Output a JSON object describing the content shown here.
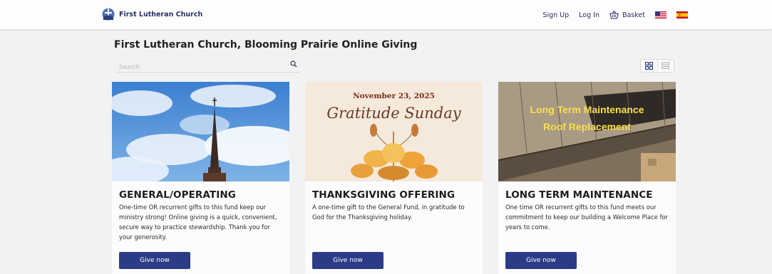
{
  "header": {
    "brand_name": "First Lutheran Church",
    "nav": {
      "signup": "Sign Up",
      "login": "Log In",
      "basket": "Basket"
    }
  },
  "page": {
    "title": "First Lutheran Church, Blooming Prairie Online Giving"
  },
  "search": {
    "placeholder": "Search"
  },
  "cards": [
    {
      "heading": "GENERAL/OPERATING",
      "description": "One-time OR recurrent gifts to this fund keep our ministry strong! Online giving is a quick, convenient, secure way to practice stewardship. Thank you for your generosity.",
      "button": "Give now"
    },
    {
      "image_date": "November 23, 2025",
      "image_title": "Gratitude Sunday",
      "heading": "THANKSGIVING OFFERING",
      "description": "A one-time gift to the General Fund, in gratitude to God for the Thanksgiving holiday.",
      "button": "Give now"
    },
    {
      "image_line1": "Long Term Maintenance",
      "image_line2": "Roof Replacement",
      "heading": "LONG TERM MAINTENANCE",
      "description": "One time OR recurrent gifts to this fund meets our commitment to keep our building a Welcome Place for years to come.",
      "button": "Give now"
    }
  ],
  "colors": {
    "accent": "#2b3b86",
    "nav_text": "#2a2f66"
  }
}
